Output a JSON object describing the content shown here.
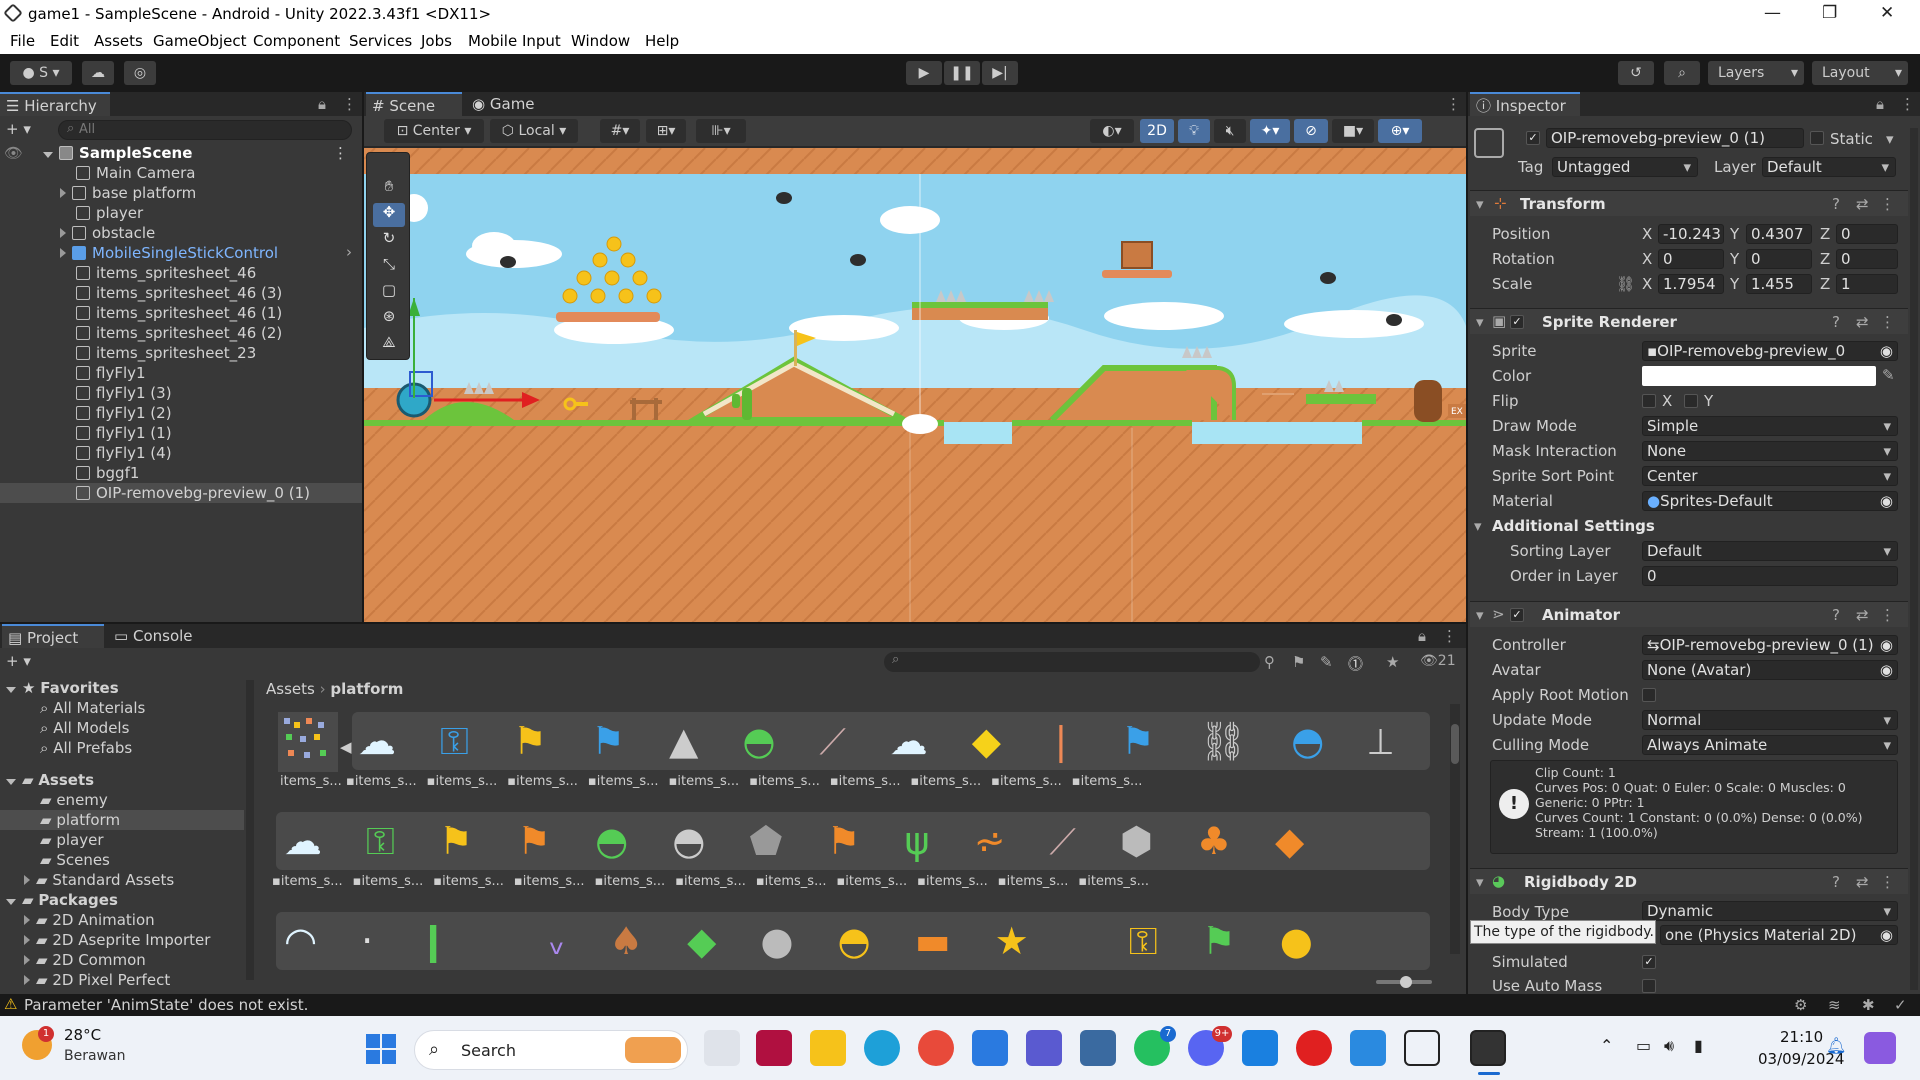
{
  "window": {
    "title": "game1 - SampleScene - Android - Unity 2022.3.43f1 <DX11>"
  },
  "menu": [
    "File",
    "Edit",
    "Assets",
    "GameObject",
    "Component",
    "Services",
    "Jobs",
    "Mobile Input",
    "Window",
    "Help"
  ],
  "toolbar": {
    "account": "S",
    "layers": "Layers",
    "layout": "Layout"
  },
  "hierarchy": {
    "tab": "Hierarchy",
    "search_placeholder": "All",
    "scene": "SampleScene",
    "items": [
      "Main Camera",
      "base platform",
      "player",
      "obstacle",
      "MobileSingleStickControl",
      "items_spritesheet_46",
      "items_spritesheet_46 (3)",
      "items_spritesheet_46 (1)",
      "items_spritesheet_46 (2)",
      "items_spritesheet_23",
      "flyFly1",
      "flyFly1 (3)",
      "flyFly1 (2)",
      "flyFly1 (1)",
      "flyFly1 (4)",
      "bggf1",
      "OIP-removebg-preview_0 (1)"
    ]
  },
  "scene_view": {
    "tabs": [
      "Scene",
      "Game"
    ],
    "pivot": "Center",
    "space": "Local",
    "mode_2d": "2D",
    "sign_text": "EX"
  },
  "inspector": {
    "tab": "Inspector",
    "object_name": "OIP-removebg-preview_0 (1)",
    "static_label": "Static",
    "tag_label": "Tag",
    "tag_value": "Untagged",
    "layer_label": "Layer",
    "layer_value": "Default",
    "transform": {
      "title": "Transform",
      "position_label": "Position",
      "rotation_label": "Rotation",
      "scale_label": "Scale",
      "pos": {
        "x": "-10.243",
        "y": "0.4307",
        "z": "0"
      },
      "rot": {
        "x": "0",
        "y": "0",
        "z": "0"
      },
      "scale": {
        "x": "1.7954",
        "y": "1.455",
        "z": "1"
      }
    },
    "sprite_renderer": {
      "title": "Sprite Renderer",
      "sprite_label": "Sprite",
      "sprite": "OIP-removebg-preview_0",
      "color_label": "Color",
      "color": "#ffffff",
      "flip_label": "Flip",
      "flip_x": "X",
      "flip_y": "Y",
      "draw_mode_label": "Draw Mode",
      "draw_mode": "Simple",
      "mask_label": "Mask Interaction",
      "mask": "None",
      "sort_point_label": "Sprite Sort Point",
      "sort_point": "Center",
      "material_label": "Material",
      "material": "Sprites-Default",
      "additional": "Additional Settings",
      "sorting_layer_label": "Sorting Layer",
      "sorting_layer": "Default",
      "order_label": "Order in Layer",
      "order": "0"
    },
    "animator": {
      "title": "Animator",
      "controller_label": "Controller",
      "controller": "OIP-removebg-preview_0 (1)",
      "avatar_label": "Avatar",
      "avatar": "None (Avatar)",
      "root_motion_label": "Apply Root Motion",
      "update_mode_label": "Update Mode",
      "update_mode": "Normal",
      "culling_label": "Culling Mode",
      "culling": "Always Animate",
      "info": [
        "Clip Count: 1",
        "Curves Pos: 0 Quat: 0 Euler: 0 Scale: 0 Muscles: 0",
        "Generic: 0 PPtr: 1",
        "Curves Count: 1 Constant: 0 (0.0%) Dense: 0 (0.0%)",
        "Stream: 1 (100.0%)"
      ]
    },
    "rigidbody": {
      "title": "Rigidbody 2D",
      "body_type_label": "Body Type",
      "body_type": "Dynamic",
      "tooltip": "The type of the rigidbody.",
      "material": "one (Physics Material 2D)",
      "simulated_label": "Simulated",
      "auto_mass_label": "Use Auto Mass"
    }
  },
  "project": {
    "tabs": [
      "Project",
      "Console"
    ],
    "favorites_label": "Favorites",
    "favorites": [
      "All Materials",
      "All Models",
      "All Prefabs"
    ],
    "assets_label": "Assets",
    "asset_folders": [
      "enemy",
      "platform",
      "player",
      "Scenes",
      "Standard Assets"
    ],
    "packages_label": "Packages",
    "packages": [
      "2D Animation",
      "2D Aseprite Importer",
      "2D Common",
      "2D Pixel Perfect"
    ],
    "breadcrumb": [
      "Assets",
      "platform"
    ],
    "hidden_count": "21",
    "first_label": "items_s...",
    "item_label": "items_s..."
  },
  "status": {
    "message": "Parameter 'AnimState' does not exist."
  },
  "taskbar": {
    "temp": "28°C",
    "weather": "Berawan",
    "search": "Search",
    "time": "21:10",
    "date": "03/09/2024",
    "badge_teams": "7",
    "badge_discord": "9+"
  }
}
